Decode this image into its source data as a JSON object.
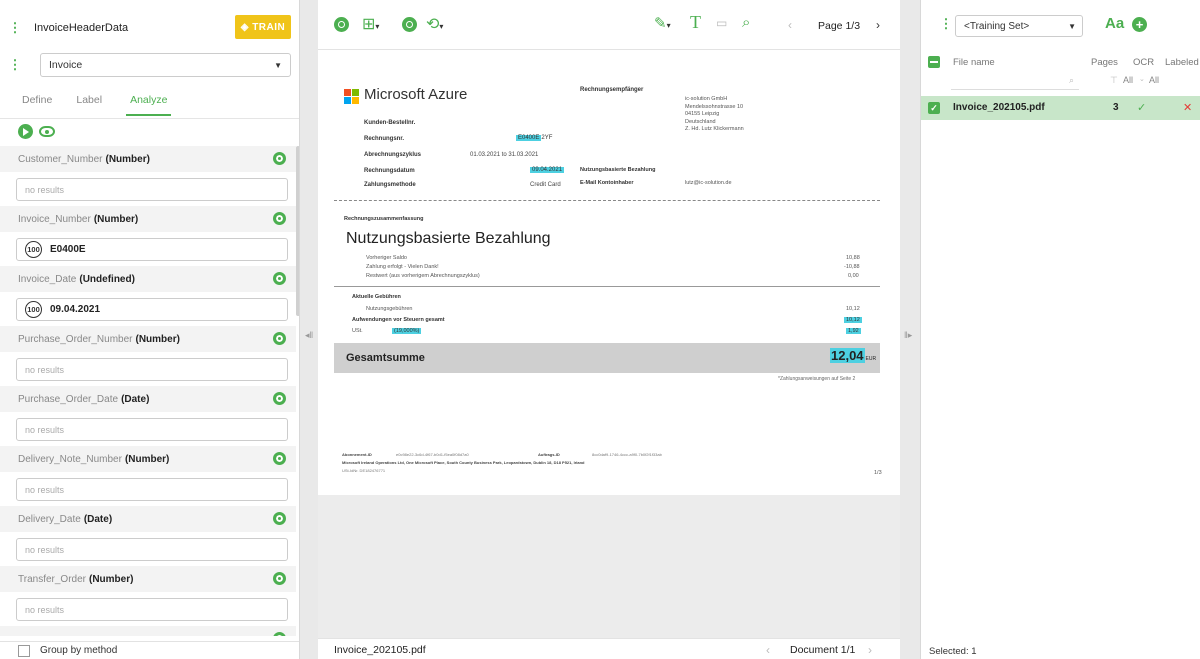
{
  "left": {
    "header_title": "InvoiceHeaderData",
    "train_label": "◈ TRAIN",
    "doc_type": "Invoice",
    "tabs": [
      "Define",
      "Label",
      "Analyze"
    ],
    "fields": [
      {
        "name": "Customer_Number",
        "type": "(Number)",
        "value": "no results",
        "confidence": ""
      },
      {
        "name": "Invoice_Number",
        "type": "(Number)",
        "value": "E0400E",
        "confidence": "100"
      },
      {
        "name": "Invoice_Date",
        "type": "(Undefined)",
        "value": "09.04.2021",
        "confidence": "100"
      },
      {
        "name": "Purchase_Order_Number",
        "type": "(Number)",
        "value": "no results",
        "confidence": ""
      },
      {
        "name": "Purchase_Order_Date",
        "type": "(Date)",
        "value": "no results",
        "confidence": ""
      },
      {
        "name": "Delivery_Note_Number",
        "type": "(Number)",
        "value": "no results",
        "confidence": ""
      },
      {
        "name": "Delivery_Date",
        "type": "(Date)",
        "value": "no results",
        "confidence": ""
      },
      {
        "name": "Transfer_Order",
        "type": "(Number)",
        "value": "no results",
        "confidence": ""
      }
    ],
    "group_by_label": "Group by method"
  },
  "center": {
    "page_label": "Page 1/3",
    "file_name": "Invoice_202105.pdf",
    "document_label": "Document 1/1",
    "doc": {
      "brand": "Microsoft Azure",
      "recipient_label": "Rechnungsempfänger",
      "recipient_lines": [
        "ic-solution GmbH",
        "Mendelssohnstrasse 10",
        "04155 Leipzig",
        "Deutschland",
        "Z. Hd. Lutz Klickermann"
      ],
      "kunden_label": "Kunden-Bestellnr.",
      "rechnungsnr_label": "Rechnungsnr.",
      "rechnungsnr_value_hl": "E0400E",
      "rechnungsnr_value_rest": "2YF",
      "zyklus_label": "Abrechnungszyklus",
      "zyklus_value": "01.03.2021 to 31.03.2021",
      "datum_label": "Rechnungsdatum",
      "datum_value": "09.04.2021",
      "zahlung_label": "Zahlungsmethode",
      "zahlung_value": "Credit Card",
      "nutzung_label": "Nutzungsbasierte Bezahlung",
      "email_label": "E-Mail Kontoinhaber",
      "email_value": "lutz@ic-solution.de",
      "summary_label": "Rechnungszusammenfassung",
      "summary_title": "Nutzungsbasierte Bezahlung",
      "lines": [
        {
          "label": "Vorheriger Saldo",
          "value": "10,88"
        },
        {
          "label": "Zahlung erfolgt - Vielen Dank!",
          "value": "-10,88"
        },
        {
          "label": "Restwert (aus vorherigem Abrechnungszyklus)",
          "value": "0,00"
        }
      ],
      "aktuelle_label": "Aktuelle Gebühren",
      "nutzungsgebuehren_label": "Nutzungsgebühren",
      "nutzungsgebuehren_value": "10,12",
      "aufwendungen_label": "Aufwendungen vor Steuern gesamt",
      "aufwendungen_value": "10,12",
      "ust_label": "USt.",
      "ust_rate": "(19,000%)",
      "ust_value": "1,92",
      "total_label": "Gesamtsumme",
      "total_value": "12,04",
      "total_currency": "EUR",
      "zahlung_note": "*Zahlungsanweisungen auf Seite 2",
      "footer_abo_label": "Abonnement-ID",
      "footer_abo_value": "e0c98e22-3c6d-4f67-b0d1-f5ea0f08d7a0",
      "footer_auftrag_label": "Auftrags-ID",
      "footer_auftrag_value": "8cc0daf9-1746-4ccc-a9f0-7b0f2f1f33ab",
      "footer_company": "Microsoft Ireland Operations Ltd, One Microsoft Place, South County Business Park, Leopardstown, Dublin 18, D18 P521, Irland",
      "footer_vat": "USt-IdNr. DE182476771",
      "footer_page": "1/3"
    }
  },
  "right": {
    "training_set": "<Training Set>",
    "aa_label": "Aa",
    "columns": [
      "File name",
      "Pages",
      "OCR",
      "Labeled"
    ],
    "filter_all": "All",
    "rows": [
      {
        "file": "Invoice_202105.pdf",
        "pages": "3",
        "ocr": "✓",
        "labeled": "✕"
      }
    ],
    "selected_label": "Selected: 1"
  },
  "colors": {
    "accent": "#4caf50",
    "train": "#f0c419",
    "highlight": "#4dd0e1",
    "selected_row": "#c8e6c9"
  }
}
